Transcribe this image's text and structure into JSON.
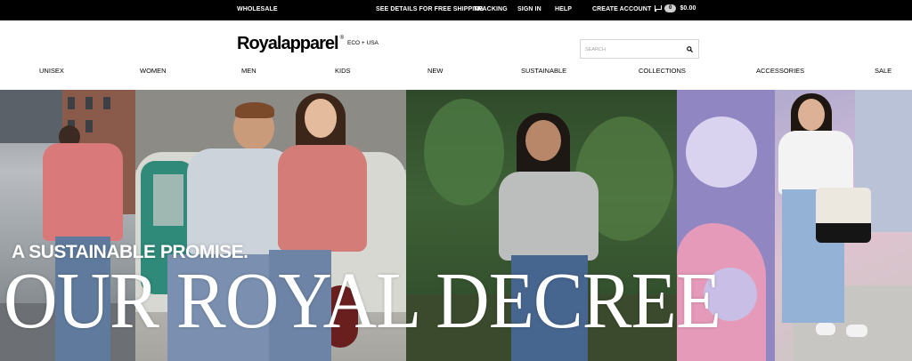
{
  "topbar": {
    "wholesale": "WHOLESALE",
    "shipping": "SEE DETAILS FOR FREE SHIPPING",
    "tracking": "TRACKING",
    "signin": "SIGN IN",
    "help": "HELP",
    "create_account": "CREATE ACCOUNT",
    "cart_count": "0",
    "cart_total": "$0.00",
    "cart_icon": "cart-icon"
  },
  "header": {
    "logo_text": "Royalapparel",
    "logo_reg": "®",
    "logo_sub": "ECO + USA",
    "search_placeholder": "SEARCH",
    "search_icon": "search-icon"
  },
  "nav": {
    "items": [
      "UNISEX",
      "WOMEN",
      "MEN",
      "KIDS",
      "NEW",
      "SUSTAINABLE",
      "COLLECTIONS",
      "ACCESSORIES",
      "SALE"
    ]
  },
  "hero": {
    "tagline": "A SUSTAINABLE PROMISE.",
    "headline": "OUR ROYAL DECREE"
  },
  "colors": {
    "topbar_bg": "#000000",
    "text": "#000000",
    "hero_text": "#ffffff"
  }
}
